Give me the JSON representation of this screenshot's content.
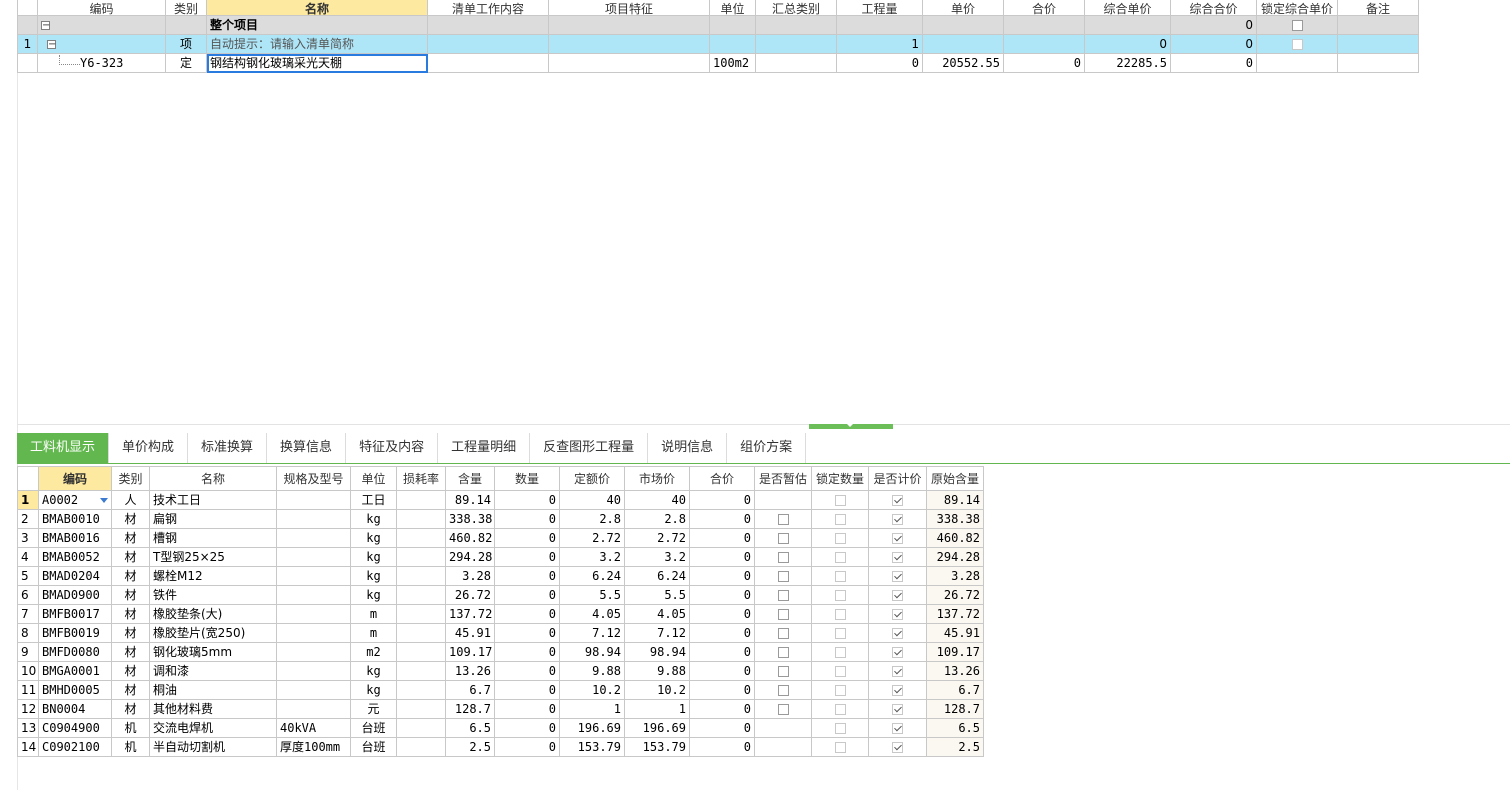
{
  "upper": {
    "columns": [
      "编码",
      "类别",
      "名称",
      "清单工作内容",
      "项目特征",
      "单位",
      "汇总类别",
      "工程量",
      "单价",
      "合价",
      "综合单价",
      "综合合价",
      "锁定综合单价",
      "备注"
    ],
    "whole_row": {
      "name": "整个项目",
      "total": "0"
    },
    "item_row": {
      "no": "1",
      "type": "项",
      "hint": "自动提示：请输入清单简称",
      "qty": "1",
      "comp_price": "0",
      "comp_total": "0"
    },
    "quota_row": {
      "code": "Y6-323",
      "type": "定",
      "name": "钢结构钢化玻璃采光天棚",
      "unit": "100m2",
      "qty": "0",
      "price": "20552.55",
      "total": "0",
      "comp_price": "22285.5",
      "comp_total": "0"
    }
  },
  "tabs": [
    "工料机显示",
    "单价构成",
    "标准换算",
    "换算信息",
    "特征及内容",
    "工程量明细",
    "反查图形工程量",
    "说明信息",
    "组价方案"
  ],
  "lower": {
    "columns": [
      "",
      "编码",
      "类别",
      "名称",
      "规格及型号",
      "单位",
      "损耗率",
      "含量",
      "数量",
      "定额价",
      "市场价",
      "合价",
      "是否暂估",
      "锁定数量",
      "是否计价",
      "原始含量"
    ],
    "rows": [
      [
        "1",
        "A0002",
        "人",
        "技术工日",
        "",
        "工日",
        "",
        "89.14",
        "0",
        "40",
        "40",
        "0",
        "",
        "89.14"
      ],
      [
        "2",
        "BMAB0010",
        "材",
        "扁钢",
        "",
        "kg",
        "",
        "338.38",
        "0",
        "2.8",
        "2.8",
        "0",
        "box",
        "338.38"
      ],
      [
        "3",
        "BMAB0016",
        "材",
        "槽钢",
        "",
        "kg",
        "",
        "460.82",
        "0",
        "2.72",
        "2.72",
        "0",
        "box",
        "460.82"
      ],
      [
        "4",
        "BMAB0052",
        "材",
        "T型钢25×25",
        "",
        "kg",
        "",
        "294.28",
        "0",
        "3.2",
        "3.2",
        "0",
        "box",
        "294.28"
      ],
      [
        "5",
        "BMAD0204",
        "材",
        "螺栓M12",
        "",
        "kg",
        "",
        "3.28",
        "0",
        "6.24",
        "6.24",
        "0",
        "box",
        "3.28"
      ],
      [
        "6",
        "BMAD0900",
        "材",
        "铁件",
        "",
        "kg",
        "",
        "26.72",
        "0",
        "5.5",
        "5.5",
        "0",
        "box",
        "26.72"
      ],
      [
        "7",
        "BMFB0017",
        "材",
        "橡胶垫条(大)",
        "",
        "m",
        "",
        "137.72",
        "0",
        "4.05",
        "4.05",
        "0",
        "box",
        "137.72"
      ],
      [
        "8",
        "BMFB0019",
        "材",
        "橡胶垫片(宽250)",
        "",
        "m",
        "",
        "45.91",
        "0",
        "7.12",
        "7.12",
        "0",
        "box",
        "45.91"
      ],
      [
        "9",
        "BMFD0080",
        "材",
        "钢化玻璃5mm",
        "",
        "m2",
        "",
        "109.17",
        "0",
        "98.94",
        "98.94",
        "0",
        "box",
        "109.17"
      ],
      [
        "10",
        "BMGA0001",
        "材",
        "调和漆",
        "",
        "kg",
        "",
        "13.26",
        "0",
        "9.88",
        "9.88",
        "0",
        "box",
        "13.26"
      ],
      [
        "11",
        "BMHD0005",
        "材",
        "桐油",
        "",
        "kg",
        "",
        "6.7",
        "0",
        "10.2",
        "10.2",
        "0",
        "box",
        "6.7"
      ],
      [
        "12",
        "BN0004",
        "材",
        "其他材料费",
        "",
        "元",
        "",
        "128.7",
        "0",
        "1",
        "1",
        "0",
        "box",
        "128.7"
      ],
      [
        "13",
        "C0904900",
        "机",
        "交流电焊机",
        "40kVA",
        "台班",
        "",
        "6.5",
        "0",
        "196.69",
        "196.69",
        "0",
        "",
        "6.5"
      ],
      [
        "14",
        "C0902100",
        "机",
        "半自动切割机",
        "厚度100mm",
        "台班",
        "",
        "2.5",
        "0",
        "153.79",
        "153.79",
        "0",
        "",
        "2.5"
      ]
    ]
  }
}
